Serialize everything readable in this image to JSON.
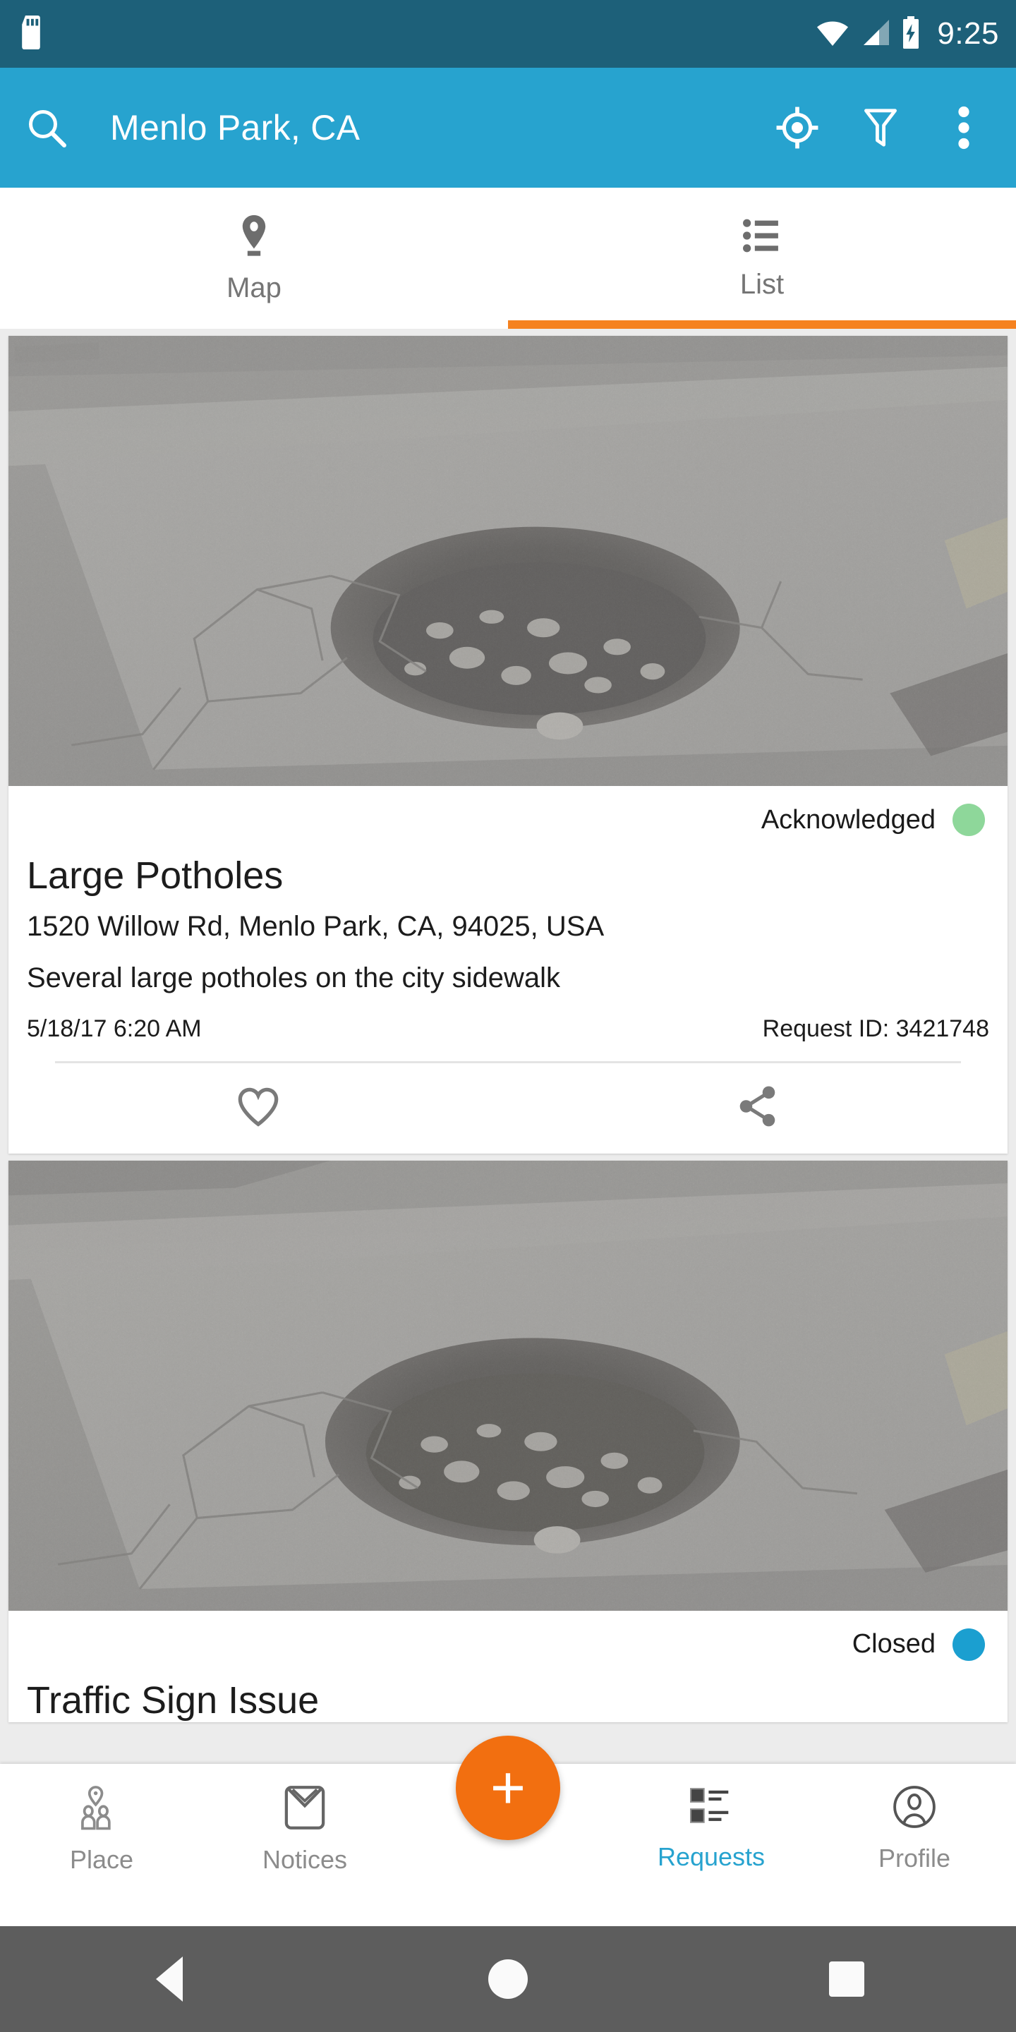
{
  "status_bar": {
    "time": "9:25",
    "icons": [
      "sd-card-icon",
      "wifi-icon",
      "cellular-signal-icon",
      "battery-charging-icon"
    ],
    "background": "#1d6079"
  },
  "app_bar": {
    "title": "Menlo Park, CA",
    "background": "#27a3cf",
    "search_icon": "search-icon",
    "locate_icon": "my-location-icon",
    "filter_icon": "filter-icon",
    "overflow_icon": "more-vertical-icon"
  },
  "tabs": {
    "active_index": 1,
    "indicator_color": "#f58220",
    "items": [
      {
        "label": "Map",
        "icon": "map-pin-icon"
      },
      {
        "label": "List",
        "icon": "list-icon"
      }
    ]
  },
  "requests": [
    {
      "status": "Acknowledged",
      "status_color": "#8ed79a",
      "title": "Large Potholes",
      "address": "1520 Willow Rd, Menlo Park, CA, 94025, USA",
      "description": "Several large potholes on the city sidewalk",
      "timestamp": "5/18/17 6:20 AM",
      "request_id": "Request ID: 3421748",
      "photo_alt": "pothole-photo",
      "favorite_icon": "heart-icon",
      "share_icon": "share-icon"
    },
    {
      "status": "Closed",
      "status_color": "#1b9fd0",
      "title": "Traffic Sign Issue",
      "photo_alt": "pothole-photo"
    }
  ],
  "bottom_nav": {
    "active_label": "Requests",
    "active_color": "#27a3cf",
    "fab": {
      "icon": "plus-icon",
      "color": "#f26f10"
    },
    "items": [
      {
        "label": "Place",
        "icon": "place-people-icon"
      },
      {
        "label": "Notices",
        "icon": "envelope-icon"
      },
      {
        "label": "Requests",
        "icon": "requests-list-icon"
      },
      {
        "label": "Profile",
        "icon": "profile-person-icon"
      }
    ]
  },
  "system_nav": {
    "background": "#5d5d5d",
    "back": "back-icon",
    "home": "home-icon",
    "recents": "recents-icon"
  }
}
